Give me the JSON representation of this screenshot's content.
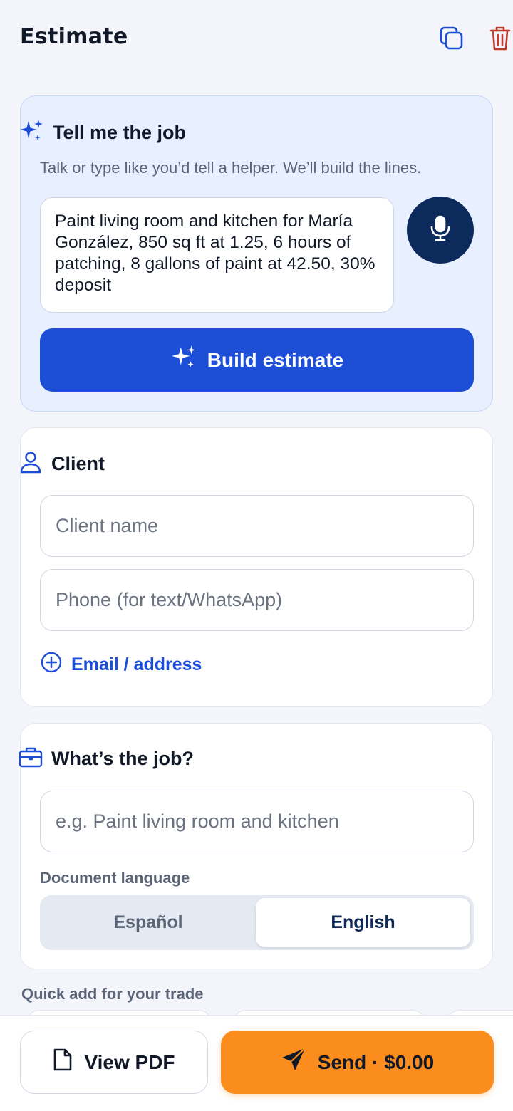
{
  "header": {
    "title": "Estimate",
    "copy_icon": "copy-icon",
    "trash_icon": "trash-icon"
  },
  "ai_card": {
    "title": "Tell me the job",
    "subtitle": "Talk or type like you’d tell a helper. We’ll build the lines.",
    "prompt_value": "Paint living room and kitchen for María González, 850 sq ft at 1.25, 6 hours of patching, 8 gallons of paint at 42.50, 30% deposit",
    "mic_icon": "microphone-icon",
    "build_label": "Build estimate"
  },
  "client": {
    "title": "Client",
    "name_placeholder": "Client name",
    "phone_placeholder": "Phone (for text/WhatsApp)",
    "email_link": "Email / address"
  },
  "job": {
    "title": "What’s the job?",
    "job_placeholder": "e.g. Paint living room and kitchen",
    "language_label": "Document language",
    "language_options": [
      "Español",
      "English"
    ],
    "language_selected": "English"
  },
  "quick_add": {
    "label": "Quick add for your trade"
  },
  "bottom": {
    "pdf_label": "View PDF",
    "send_label": "Send · $0.00"
  },
  "colors": {
    "primary": "#1d4ed8",
    "navy": "#0d2a5c",
    "accent_orange": "#fb8c1e",
    "danger": "#c0392b"
  }
}
